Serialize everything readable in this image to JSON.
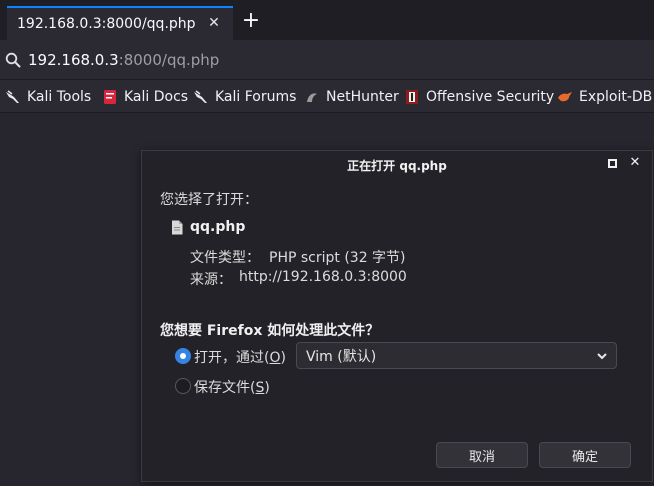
{
  "browser": {
    "tab_title": "192.168.0.3:8000/qq.php",
    "tab_close": "✕",
    "new_tab": "+",
    "url_host": "192.168.0.3",
    "url_rest": ":8000/qq.php",
    "accent": "#0a84ff"
  },
  "bookmarks": [
    {
      "label": "Kali Tools",
      "icon": "kali-dragon-icon"
    },
    {
      "label": "Kali Docs",
      "icon": "kali-docs-icon"
    },
    {
      "label": "Kali Forums",
      "icon": "kali-dragon-icon"
    },
    {
      "label": "NetHunter",
      "icon": "nethunter-icon"
    },
    {
      "label": "Offensive Security",
      "icon": "offsec-icon"
    },
    {
      "label": "Exploit-DB",
      "icon": "exploitdb-icon"
    }
  ],
  "dialog": {
    "title": "正在打开 qq.php",
    "intro": "您选择了打开：",
    "filename": "qq.php",
    "file_type_label": "文件类型：",
    "file_type_value": "PHP script (32 字节)",
    "source_label": "来源：",
    "source_value": "http://192.168.0.3:8000",
    "question": "您想要 Firefox 如何处理此文件？",
    "open_with_label": "打开，通过(",
    "open_with_key": "O",
    "open_with_suffix": ")",
    "app_selected": "Vim (默认)",
    "save_label": "保存文件(",
    "save_key": "S",
    "save_suffix": ")",
    "cancel_label": "取消",
    "ok_label": "确定",
    "radio_color": "#3584e4"
  }
}
